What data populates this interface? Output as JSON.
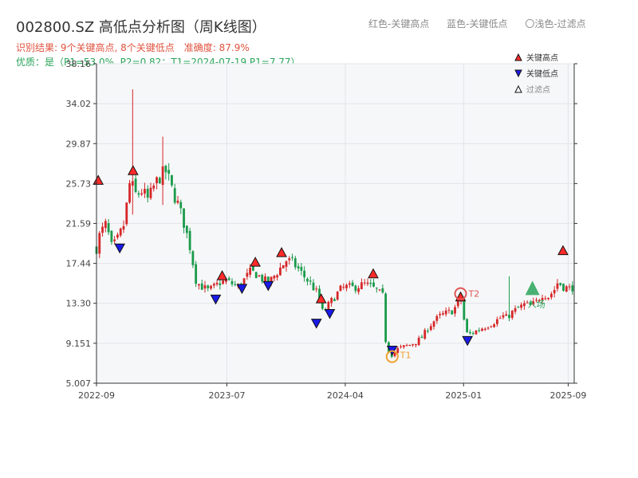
{
  "chart_data": {
    "type": "candlestick",
    "title": "002800.SZ 高低点分析图（周K线图）",
    "color_legend": {
      "high": "红色-关键高点",
      "low": "蓝色-关键低点",
      "filtered": "〇浅色-过滤点"
    },
    "result_line": {
      "counts": "识别结果: 9个关键高点, 8个关键低点",
      "accuracy": "准确度: 87.9%"
    },
    "quality_line": "优质：是（P1=53.0%, P2=0.82；T1=2024-07-19 P1=7.77）",
    "y_ticks": [
      "5.007",
      "9.151",
      "13.30",
      "17.44",
      "21.59",
      "25.73",
      "29.87",
      "34.02",
      "38.16"
    ],
    "ylim": [
      5.007,
      38.16
    ],
    "x_ticks": [
      "2022-09",
      "2023-07",
      "2024-04",
      "2025-01",
      "2025-09"
    ],
    "x_tick_dates": [
      "2022-09-01",
      "2023-07-01",
      "2024-04-01",
      "2025-01-01",
      "2025-09-01"
    ],
    "xlim": [
      "2022-09-01",
      "2025-09-15"
    ],
    "colors": {
      "up": "#d62728",
      "down": "#1a9a4a",
      "key_high": "#ff2a2a",
      "key_low": "#1a1ae6",
      "t1": "#f0a030",
      "t2": "#e05555",
      "entry": "#2aa45a",
      "plot_bg": "#f6f7f9",
      "grid": "#e2e4e8"
    },
    "price_anchors": [
      [
        "2022-09-01",
        19.0
      ],
      [
        "2022-09-09",
        20.5
      ],
      [
        "2022-09-23",
        21.5
      ],
      [
        "2022-10-07",
        19.0
      ],
      [
        "2022-10-21",
        20.0
      ],
      [
        "2022-11-04",
        21.5
      ],
      [
        "2022-11-18",
        26.0
      ],
      [
        "2022-12-02",
        24.5
      ],
      [
        "2022-12-16",
        25.0
      ],
      [
        "2022-12-30",
        24.0
      ],
      [
        "2023-01-13",
        25.5
      ],
      [
        "2023-01-27",
        26.5
      ],
      [
        "2023-02-10",
        27.0
      ],
      [
        "2023-02-24",
        25.0
      ],
      [
        "2023-03-10",
        23.5
      ],
      [
        "2023-03-24",
        21.5
      ],
      [
        "2023-04-07",
        19.0
      ],
      [
        "2023-04-21",
        15.5
      ],
      [
        "2023-05-05",
        15.0
      ],
      [
        "2023-05-19",
        14.6
      ],
      [
        "2023-06-02",
        15.0
      ],
      [
        "2023-06-16",
        15.5
      ],
      [
        "2023-06-30",
        15.6
      ],
      [
        "2023-07-14",
        15.3
      ],
      [
        "2023-07-28",
        15.0
      ],
      [
        "2023-08-11",
        15.8
      ],
      [
        "2023-08-25",
        16.6
      ],
      [
        "2023-09-08",
        16.3
      ],
      [
        "2023-09-22",
        15.8
      ],
      [
        "2023-10-06",
        15.4
      ],
      [
        "2023-10-20",
        16.2
      ],
      [
        "2023-11-03",
        17.0
      ],
      [
        "2023-11-17",
        17.8
      ],
      [
        "2023-12-01",
        17.5
      ],
      [
        "2023-12-15",
        16.8
      ],
      [
        "2023-12-29",
        16.0
      ],
      [
        "2024-01-12",
        15.3
      ],
      [
        "2024-01-26",
        14.4
      ],
      [
        "2024-02-09",
        12.3
      ],
      [
        "2024-02-23",
        13.2
      ],
      [
        "2024-03-08",
        14.0
      ],
      [
        "2024-03-22",
        14.8
      ],
      [
        "2024-04-05",
        15.0
      ],
      [
        "2024-04-19",
        14.9
      ],
      [
        "2024-05-03",
        15.1
      ],
      [
        "2024-05-17",
        15.3
      ],
      [
        "2024-05-31",
        15.0
      ],
      [
        "2024-06-14",
        14.6
      ],
      [
        "2024-06-28",
        14.0
      ],
      [
        "2024-07-05",
        8.7
      ],
      [
        "2024-07-19",
        7.9
      ],
      [
        "2024-08-02",
        8.6
      ],
      [
        "2024-08-16",
        8.8
      ],
      [
        "2024-08-30",
        9.0
      ],
      [
        "2024-09-13",
        9.3
      ],
      [
        "2024-09-27",
        9.8
      ],
      [
        "2024-10-11",
        10.8
      ],
      [
        "2024-10-25",
        11.5
      ],
      [
        "2024-11-08",
        12.0
      ],
      [
        "2024-11-22",
        12.3
      ],
      [
        "2024-12-06",
        12.5
      ],
      [
        "2024-12-20",
        13.3
      ],
      [
        "2024-12-27",
        13.9
      ],
      [
        "2025-01-03",
        11.2
      ],
      [
        "2025-01-10",
        10.0
      ],
      [
        "2025-01-24",
        10.3
      ],
      [
        "2025-02-07",
        10.6
      ],
      [
        "2025-02-21",
        10.9
      ],
      [
        "2025-03-07",
        11.2
      ],
      [
        "2025-03-21",
        11.6
      ],
      [
        "2025-04-04",
        12.0
      ],
      [
        "2025-04-11",
        11.8
      ],
      [
        "2025-04-25",
        12.4
      ],
      [
        "2025-05-09",
        12.8
      ],
      [
        "2025-05-23",
        13.2
      ],
      [
        "2025-06-06",
        13.0
      ],
      [
        "2025-06-20",
        13.5
      ],
      [
        "2025-07-04",
        14.3
      ],
      [
        "2025-07-18",
        14.0
      ],
      [
        "2025-08-01",
        14.8
      ],
      [
        "2025-08-08",
        15.5
      ],
      [
        "2025-08-22",
        15.0
      ],
      [
        "2025-09-05",
        14.8
      ],
      [
        "2025-09-12",
        15.0
      ]
    ],
    "price_spikes": [
      [
        "2022-11-25",
        35.5,
        22.5
      ],
      [
        "2023-02-03",
        30.6,
        23.5
      ],
      [
        "2025-04-18",
        16.1,
        11.5
      ]
    ],
    "key_highs": [
      [
        "2022-09-05",
        26.1
      ],
      [
        "2022-11-25",
        27.1
      ],
      [
        "2023-06-20",
        16.2
      ],
      [
        "2023-09-05",
        17.6
      ],
      [
        "2023-11-05",
        18.6
      ],
      [
        "2024-02-05",
        13.8
      ],
      [
        "2024-06-05",
        16.4
      ],
      [
        "2024-12-25",
        14.0
      ],
      [
        "2025-08-20",
        18.8
      ]
    ],
    "key_lows": [
      [
        "2022-10-25",
        19.0
      ],
      [
        "2023-06-05",
        13.7
      ],
      [
        "2023-08-05",
        14.8
      ],
      [
        "2023-10-05",
        15.1
      ],
      [
        "2024-01-25",
        11.2
      ],
      [
        "2024-02-25",
        12.2
      ],
      [
        "2024-07-19",
        8.4
      ],
      [
        "2025-01-10",
        9.4
      ]
    ],
    "t1": {
      "date": "2024-07-19",
      "value": 7.77,
      "label": "T1"
    },
    "t2": {
      "date": "2024-12-25",
      "value": 14.3,
      "label": "T2"
    },
    "entry": {
      "date": "2025-06-10",
      "value": 14.4,
      "label": "入场"
    },
    "legend": [
      {
        "label": "关键高点",
        "marker": "triangle-up",
        "color": "#ff2a2a"
      },
      {
        "label": "关键低点",
        "marker": "triangle-down",
        "color": "#1a1ae6"
      },
      {
        "label": "过滤点",
        "marker": "triangle-up-hollow",
        "color": "#ffffff"
      }
    ],
    "grid": true,
    "legend_position": "top-right"
  }
}
